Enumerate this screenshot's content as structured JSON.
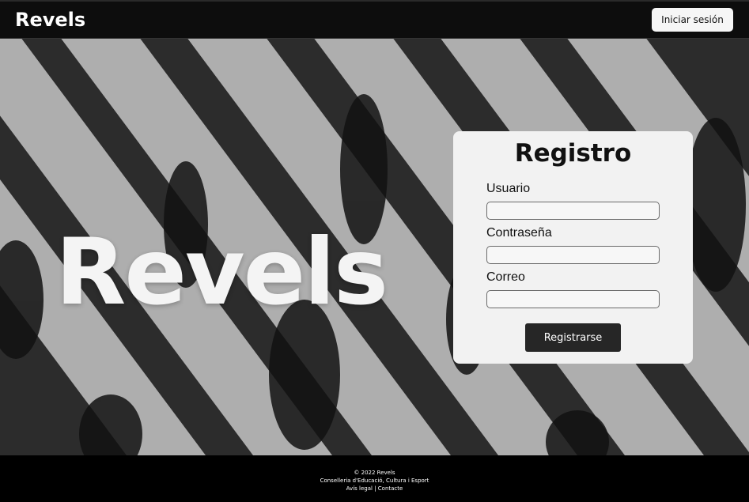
{
  "header": {
    "brand": "Revels",
    "login_label": "Iniciar sesión"
  },
  "hero": {
    "title": "Revels"
  },
  "register": {
    "title": "Registro",
    "fields": [
      {
        "label": "Usuario",
        "value": ""
      },
      {
        "label": "Contraseña",
        "value": ""
      },
      {
        "label": "Correo",
        "value": ""
      }
    ],
    "submit_label": "Registrarse"
  },
  "footer": {
    "copyright": "© 2022 Revels",
    "org": "Conselleria d'Educació, Cultura i Esport",
    "legal_link": "Avís legal",
    "separator": "|",
    "contact_link": "Contacte"
  },
  "colors": {
    "navbar_bg": "#0d0d0d",
    "card_bg": "#f2f2f2",
    "button_dark": "#262626"
  }
}
